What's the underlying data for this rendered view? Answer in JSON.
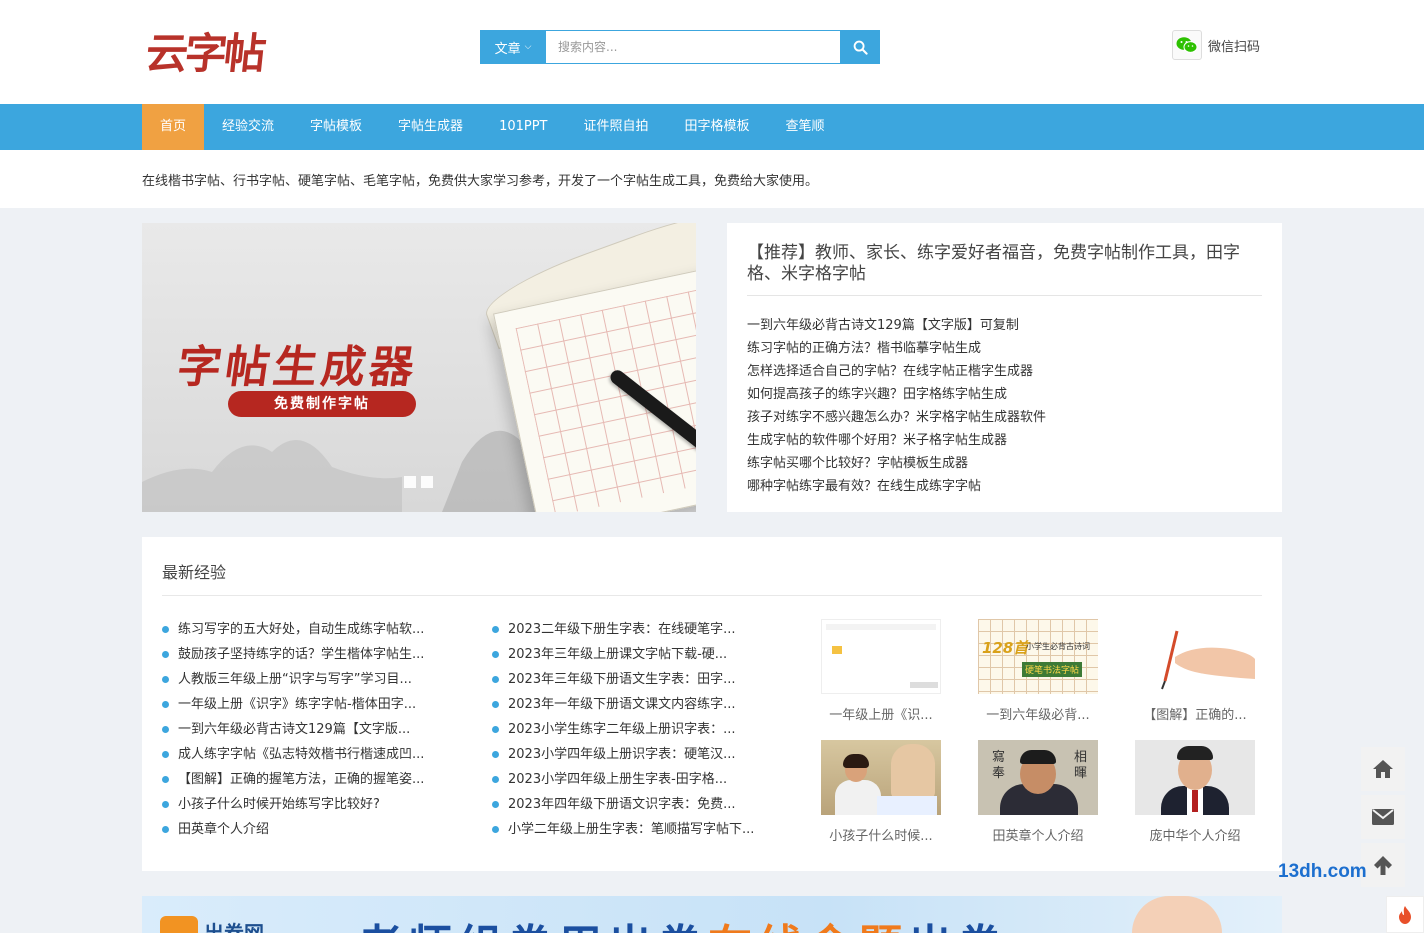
{
  "header": {
    "logo_text": "云字帖",
    "search": {
      "category": "文章",
      "placeholder": "搜索内容..."
    },
    "wechat_label": "微信扫码"
  },
  "nav": {
    "items": [
      "首页",
      "经验交流",
      "字帖模板",
      "字帖生成器",
      "101PPT",
      "证件照自拍",
      "田字格模板",
      "查笔顺"
    ],
    "active_index": 0
  },
  "tagline": "在线楷书字帖、行书字帖、硬笔字帖、毛笔字帖，免费供大家学习参考，开发了一个字帖生成工具，免费给大家使用。",
  "banner": {
    "title": "字帖生成器",
    "subtitle": "免费制作字帖",
    "slide_count": 2
  },
  "recommend": {
    "title": "【推荐】教师、家长、练字爱好者福音，免费字帖制作工具，田字格、米字格字帖",
    "items": [
      "一到六年级必背古诗文129篇【文字版】可复制",
      "练习字帖的正确方法？楷书临摹字帖生成",
      "怎样选择适合自己的字帖？在线字帖正楷字生成器",
      "如何提高孩子的练字兴趣？田字格练字帖生成",
      "孩子对练字不感兴趣怎么办？米字格字帖生成器软件",
      "生成字帖的软件哪个好用？米子格字帖生成器",
      "练字帖买哪个比较好？字帖模板生成器",
      "哪种字帖练字最有效？在线生成练字字帖"
    ]
  },
  "latest": {
    "title": "最新经验",
    "col1": [
      "练习写字的五大好处，自动生成练字帖软...",
      "鼓励孩子坚持练字的话？学生楷体字帖生...",
      "人教版三年级上册“识字与写字”学习目...",
      "一年级上册《识字》练字字帖-楷体田字...",
      "一到六年级必背古诗文129篇【文字版...",
      "成人练字字帖《弘志特效楷书行楷速成凹...",
      "【图解】正确的握笔方法，正确的握笔姿...",
      "小孩子什么时候开始练写字比较好?",
      "田英章个人介绍"
    ],
    "col2": [
      "2023二年级下册生字表：在线硬笔字...",
      "2023年三年级上册课文字帖下载-硬...",
      "2023年三年级下册语文生字表：田字...",
      "2023年一年级下册语文课文内容练字...",
      "2023小学生练字二年级上册识字表：...",
      "2023小学四年级上册识字表：硬笔汉...",
      "2023小学四年级上册生字表-田字格...",
      "2023年四年级下册语文识字表：免费...",
      "小学二年级上册生字表：笔顺描写字帖下..."
    ],
    "thumbs": [
      {
        "caption": "一年级上册《识..."
      },
      {
        "caption": "一到六年级必背...",
        "badge": "128首",
        "badge_sub": "硬笔书法字帖",
        "badge_note": "小学生必背古诗词"
      },
      {
        "caption": "【图解】正确的..."
      },
      {
        "caption": "小孩子什么时候..."
      },
      {
        "caption": "田英章个人介绍",
        "side_left": "寫奉",
        "side_right": "相暉"
      },
      {
        "caption": "庞中华个人介绍"
      }
    ]
  },
  "bottom_banner": {
    "logo": "出卷网",
    "slogan_a": "老师组卷用出卷",
    "slogan_hl": "在线命题",
    "slogan_b": "出卷"
  },
  "side_tools": [
    "home-icon",
    "mail-icon",
    "arrow-up-icon"
  ],
  "watermark": "13dh.com",
  "colors": {
    "primary": "#3ca6de",
    "active_nav": "#f0a142",
    "logo_red": "#b8322a"
  }
}
